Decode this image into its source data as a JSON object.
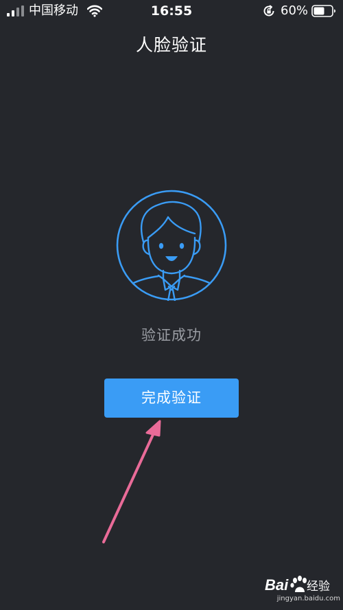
{
  "status_bar": {
    "carrier": "中国移动",
    "time": "16:55",
    "battery_percent": "60%",
    "battery_level": 0.6,
    "signal_icon": "cellular-signal-icon",
    "wifi_icon": "wifi-icon",
    "lock_icon": "rotation-lock-icon",
    "battery_icon": "battery-icon"
  },
  "header": {
    "title": "人脸验证"
  },
  "main": {
    "illustration_icon": "face-avatar-icon",
    "status_text": "验证成功",
    "complete_button_label": "完成验证"
  },
  "watermark": {
    "brand": "Baidu经验",
    "url": "jingyan.baidu.com"
  },
  "colors": {
    "background": "#25272c",
    "accent": "#3a9cf5",
    "status_text": "#9a9da3",
    "annotation_arrow": "#e96b98"
  }
}
